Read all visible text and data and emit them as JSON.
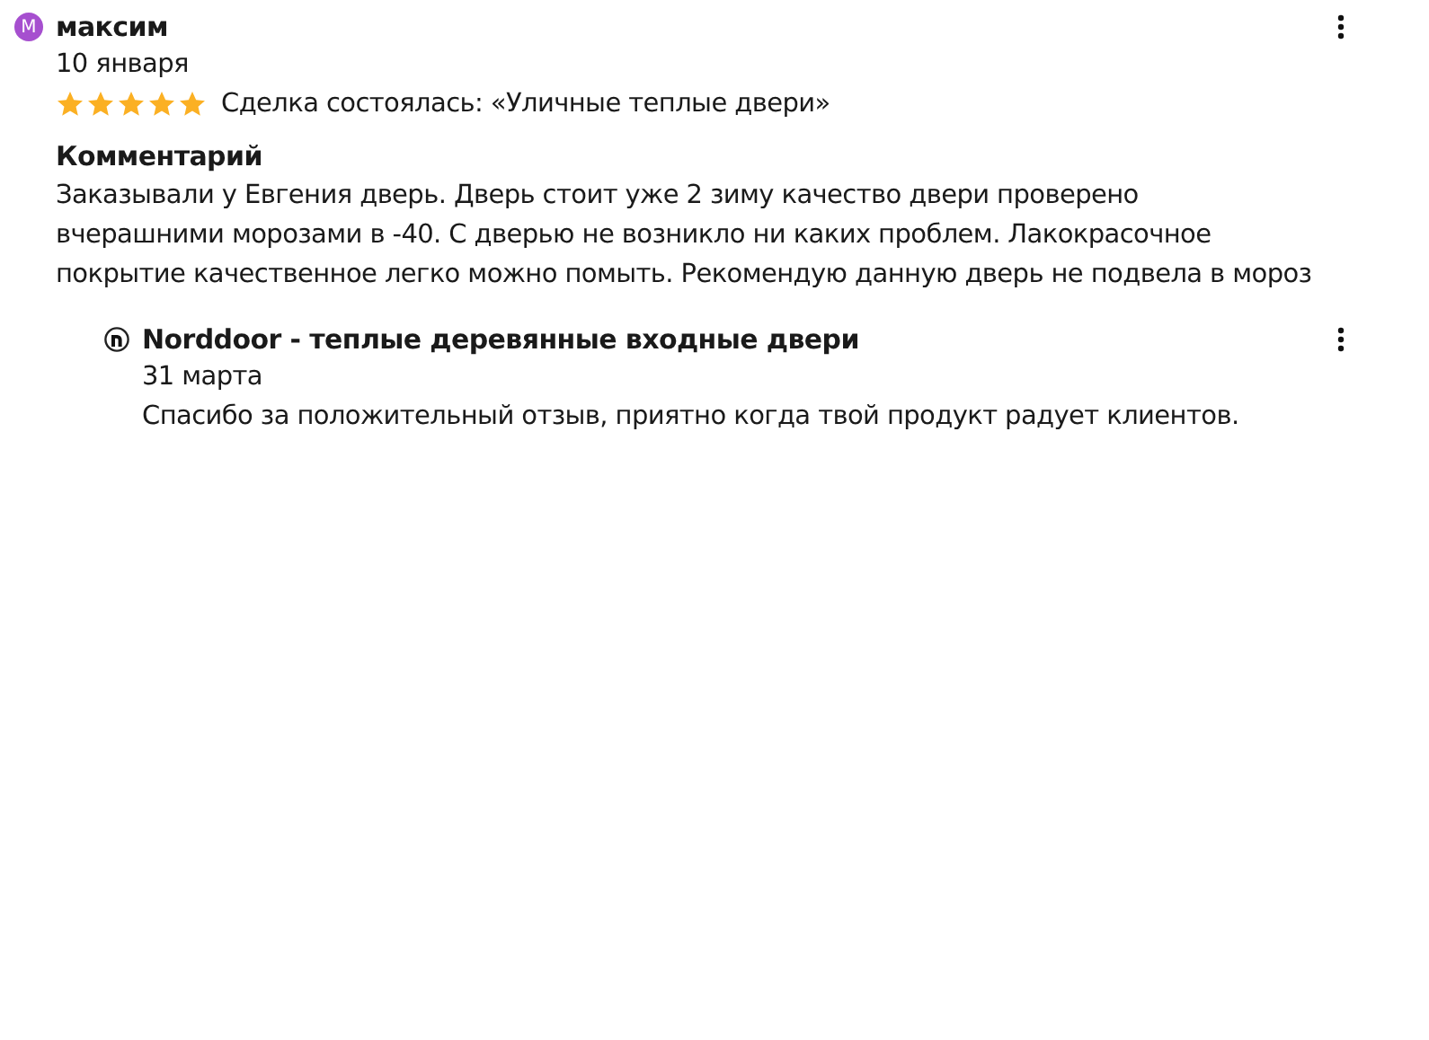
{
  "review": {
    "avatar_letter": "М",
    "author": "максим",
    "date": "10 января",
    "stars": 5,
    "deal": "Сделка состоялась: «Уличные теплые двери»",
    "comment_heading": "Комментарий",
    "comment": "Заказывали у Евгения дверь. Дверь стоит уже 2 зиму качество двери проверено вчерашними морозами в -40. С дверью не возникло ни каких проблем. Лакокрасочное покрытие качественное легко можно помыть. Рекомендую данную дверь не подвела в мороз"
  },
  "reply": {
    "author": "Norddoor - теплые деревянные входные двери",
    "date": "31 марта",
    "text": "Спасибо за положительный отзыв, приятно когда твой продукт радует клиентов."
  }
}
